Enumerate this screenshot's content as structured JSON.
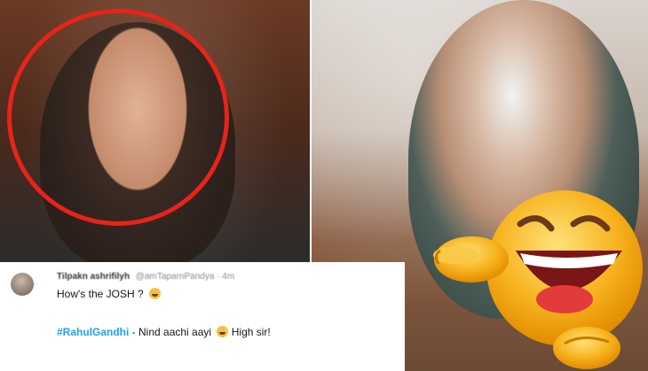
{
  "tweet": {
    "name": "Tilpakn ashrifilyh",
    "handle": "@amTaparnPandya",
    "time": "4m",
    "line1": "How's the JOSH ?",
    "hashtag": "#RahulGandhi",
    "line2_rest": " - Nind aachi aayi",
    "line2_end": "High sir!"
  },
  "colors": {
    "circle": "#e8231b",
    "hashtag": "#1da1f2",
    "emoji": "#f6c143"
  },
  "icons": [
    "grinning-emoji-icon",
    "sleeping-emoji-icon",
    "laughing-pointing-emoji-icon"
  ]
}
